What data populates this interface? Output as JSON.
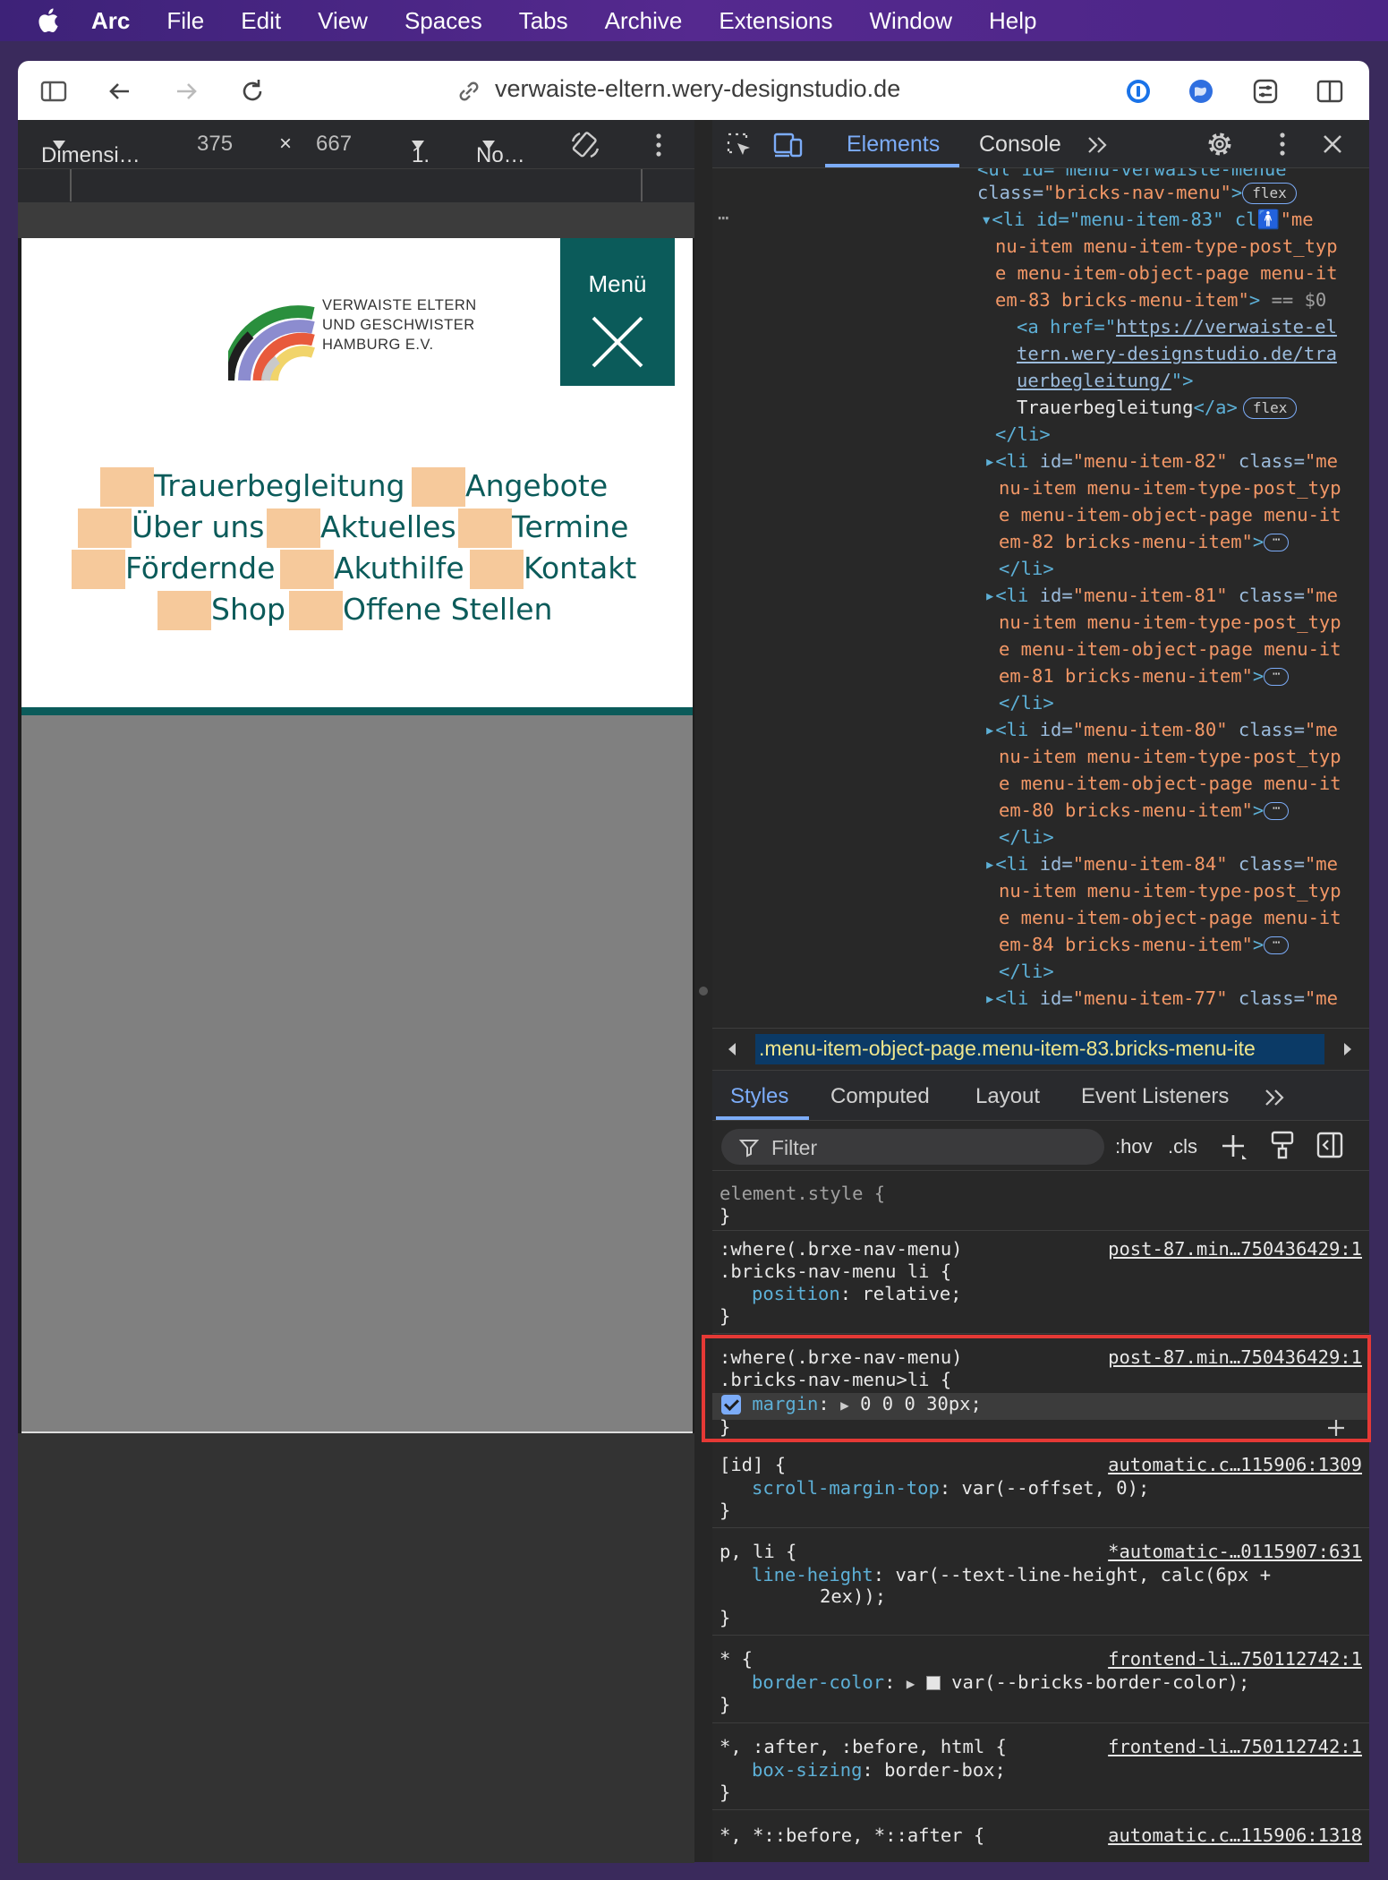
{
  "menubar": {
    "app": "Arc",
    "items": [
      "File",
      "Edit",
      "View",
      "Spaces",
      "Tabs",
      "Archive",
      "Extensions",
      "Window",
      "Help"
    ]
  },
  "browser": {
    "url": "verwaiste-eltern.wery-designstudio.de"
  },
  "device_toolbar": {
    "dimensions_label": "Dimensi…",
    "width": "375",
    "times": "×",
    "height": "667",
    "zoom": "1.",
    "throttle": "No…"
  },
  "site": {
    "logo_lines": [
      "VERWAISTE ELTERN",
      "UND GESCHWISTER",
      "HAMBURG E.V."
    ],
    "menu_button": "Menü",
    "nav": [
      [
        "Trauerbegleitung",
        "Angebote"
      ],
      [
        "Über uns",
        "Aktuelles",
        "Termine"
      ],
      [
        "Fördernde",
        "Akuthilfe",
        "Kontakt"
      ],
      [
        "Shop",
        "Offene Stellen"
      ]
    ]
  },
  "devtools": {
    "tabs": [
      "Elements",
      "Console"
    ],
    "elements_lines": {
      "l0": "<ul id=\"menu-verwaiste-menue\"",
      "l1a": "class=",
      "l1b": "\"bricks-nav-menu\"",
      "flex": "flex",
      "sel1": "<li id=\"menu-item-83\" cl",
      "sel1b": "\"me",
      "sel2": "nu-item menu-item-type-post_typ",
      "sel3": "e menu-item-object-page menu-it",
      "sel4": "em-83 bricks-menu-item\"",
      "sel4b": "== $0",
      "a1": "<a href=\"",
      "a1link": "https://verwaiste-el",
      "a2link": "tern.wery-designstudio.de/tra",
      "a3link": "uerbegleitung/",
      "a3end": "\">",
      "a4": "Trauerbegleitung",
      "a4end": "</a>",
      "li_close": "</li>",
      "items": [
        "82",
        "81",
        "80",
        "84"
      ],
      "last_item": "77"
    },
    "breadcrumb": ".menu-item-object-page.menu-item-83.bricks-menu-ite",
    "style_tabs": [
      "Styles",
      "Computed",
      "Layout",
      "Event Listeners"
    ],
    "filter_placeholder": "Filter",
    "hov": ":hov",
    "cls": ".cls",
    "rules": {
      "r0_sel": "element.style {",
      "brace": "}",
      "r1_sel1": ":where(.brxe-nav-menu)",
      "r1_sel2": ".bricks-nav-menu li {",
      "r1_prop": "position",
      "r1_val": " relative;",
      "r1_src": "post-87.min…750436429:1",
      "r2_sel1": ":where(.brxe-nav-menu)",
      "r2_sel2": ".bricks-nav-menu>li {",
      "r2_prop": "margin",
      "r2_val": "0 0 0 30px;",
      "r2_src": "post-87.min…750436429:1",
      "r3_sel": "[id] {",
      "r3_prop": "scroll-margin-top",
      "r3_val": " var(--offset, 0);",
      "r3_src": "automatic.c…115906:1309",
      "r4_sel": "p, li {",
      "r4_prop": "line-height",
      "r4_val": " var(--text-line-height, calc(6px +",
      "r4_val2": "2ex));",
      "r4_src": "*automatic-…0115907:631",
      "r5_sel": "* {",
      "r5_prop": "border-color",
      "r5_val": "var(--bricks-border-color);",
      "r5_src": "frontend-li…750112742:1",
      "r6_sel": "*, :after, :before, html {",
      "r6_prop": "box-sizing",
      "r6_val": " border-box;",
      "r6_src": "frontend-li…750112742:1",
      "r7_sel": "*, *::before, *::after {",
      "r7_src": "automatic.c…115906:1318"
    }
  },
  "colors": {
    "teal": "#0b5b5a",
    "highlight_box": "#e53935",
    "pad": "#f6c99b"
  }
}
